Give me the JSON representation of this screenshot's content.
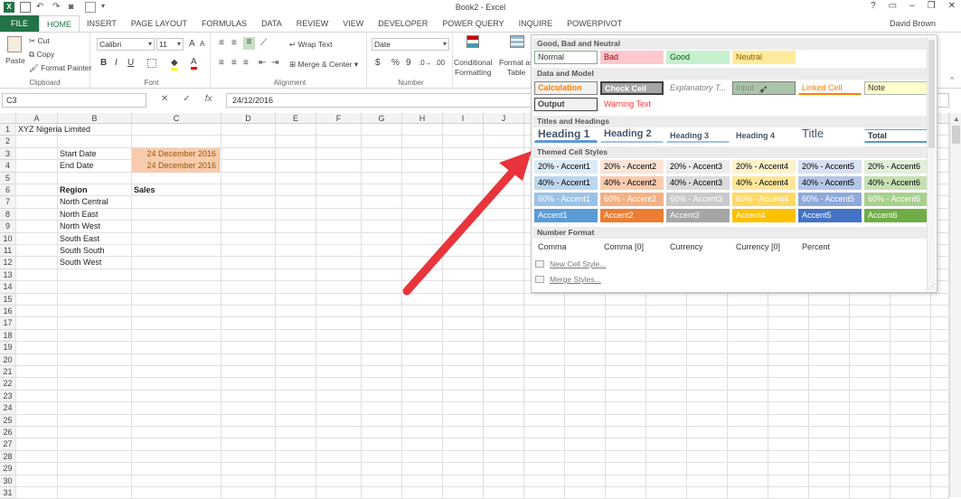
{
  "window": {
    "title": "Book2 - Excel",
    "user": "David Brown",
    "controls": [
      "?",
      "▭",
      "–",
      "❐",
      "✕"
    ]
  },
  "tabs": [
    {
      "label": "FILE"
    },
    {
      "label": "HOME"
    },
    {
      "label": "INSERT"
    },
    {
      "label": "PAGE LAYOUT"
    },
    {
      "label": "FORMULAS"
    },
    {
      "label": "DATA"
    },
    {
      "label": "REVIEW"
    },
    {
      "label": "VIEW"
    },
    {
      "label": "DEVELOPER"
    },
    {
      "label": "POWER QUERY"
    },
    {
      "label": "INQUIRE"
    },
    {
      "label": "POWERPIVOT"
    }
  ],
  "ribbon": {
    "clipboard": {
      "paste": "Paste",
      "cut": "Cut",
      "copy": "Copy",
      "format_painter": "Format Painter",
      "label": "Clipboard"
    },
    "font": {
      "name": "Calibri",
      "size": "11",
      "bold": "B",
      "italic": "I",
      "underline": "U",
      "grow": "A",
      "shrink": "A",
      "label": "Font"
    },
    "alignment": {
      "wrap": "Wrap Text",
      "merge": "Merge & Center",
      "label": "Alignment"
    },
    "number": {
      "format": "Date",
      "currency": "$",
      "percent": "%",
      "comma": "9",
      "label": "Number"
    },
    "styles": {
      "conditional": "Conditional",
      "conditional2": "Formatting",
      "format_as": "Format as",
      "table": "Table"
    }
  },
  "formula_bar": {
    "name_box": "C3",
    "cancel": "✕",
    "enter": "✓",
    "fx": "fx",
    "value": "24/12/2016"
  },
  "grid": {
    "columns": [
      "A",
      "B",
      "C",
      "D",
      "E",
      "F",
      "G",
      "H",
      "I",
      "J"
    ],
    "rows": [
      "1",
      "2",
      "3",
      "4",
      "5",
      "6",
      "7",
      "8",
      "9",
      "10",
      "11",
      "12",
      "13",
      "14",
      "15",
      "16",
      "17",
      "18",
      "19",
      "20",
      "21",
      "22",
      "23",
      "24",
      "25",
      "26",
      "27",
      "28",
      "29",
      "30",
      "31"
    ],
    "a1": "XYZ Nigeria Limited",
    "b3": "Start Date",
    "c3": "24 December 2016",
    "b4": "End Date",
    "c4": "24 December 2016",
    "b6": "Region",
    "c6": "Sales",
    "regions": [
      "North Central",
      "North East",
      "North West",
      "South East",
      "South South",
      "South West"
    ]
  },
  "gallery": {
    "sections": {
      "good_bad": "Good, Bad and Neutral",
      "data_model": "Data and Model",
      "titles": "Titles and Headings",
      "themed": "Themed Cell Styles",
      "number": "Number Format"
    },
    "good_bad": [
      "Normal",
      "Bad",
      "Good",
      "Neutral"
    ],
    "data_model_1": [
      "Calculation",
      "Check Cell",
      "Explanatory T...",
      "Input",
      "Linked Cell",
      "Note"
    ],
    "data_model_2": [
      "Output",
      "Warning Text"
    ],
    "titles": [
      "Heading 1",
      "Heading 2",
      "Heading 3",
      "Heading 4",
      "Title",
      "Total"
    ],
    "accent20": [
      "20% - Accent1",
      "20% - Accent2",
      "20% - Accent3",
      "20% - Accent4",
      "20% - Accent5",
      "20% - Accent6"
    ],
    "accent40": [
      "40% - Accent1",
      "40% - Accent2",
      "40% - Accent3",
      "40% - Accent4",
      "40% - Accent5",
      "40% - Accent6"
    ],
    "accent60": [
      "60% - Accent1",
      "60% - Accent2",
      "60% - Accent3",
      "60% - Accent4",
      "60% - Accent5",
      "60% - Accent6"
    ],
    "accent100": [
      "Accent1",
      "Accent2",
      "Accent3",
      "Accent4",
      "Accent5",
      "Accent6"
    ],
    "number_format": [
      "Comma",
      "Comma [0]",
      "Currency",
      "Currency [0]",
      "Percent"
    ],
    "new_style": "New Cell Style...",
    "merge_styles": "Merge Styles..."
  },
  "colors": {
    "excel_green": "#217346",
    "accent1": "#5b9bd5",
    "accent2": "#ed7d31",
    "accent3": "#a5a5a5",
    "accent4": "#ffc000",
    "accent5": "#4472c4",
    "accent6": "#70ad47",
    "arrow": "#e8343a"
  }
}
